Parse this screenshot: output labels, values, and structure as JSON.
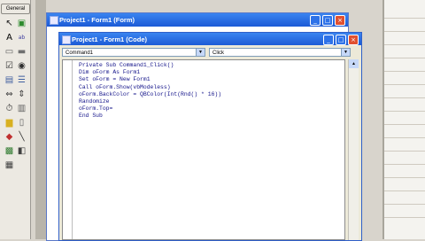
{
  "toolbox": {
    "tab_label": "General",
    "tools": [
      {
        "name": "pointer-icon",
        "glyph": "↖",
        "color": "#202020"
      },
      {
        "name": "picturebox-icon",
        "glyph": "▣",
        "color": "#2e8b2e"
      },
      {
        "name": "label-icon",
        "glyph": "A",
        "color": "#000000"
      },
      {
        "name": "textbox-icon",
        "glyph": "ab",
        "color": "#4040a0"
      },
      {
        "name": "frame-icon",
        "glyph": "▭",
        "color": "#606060"
      },
      {
        "name": "commandbutton-icon",
        "glyph": "▬",
        "color": "#707070"
      },
      {
        "name": "checkbox-icon",
        "glyph": "☑",
        "color": "#303030"
      },
      {
        "name": "optionbutton-icon",
        "glyph": "◉",
        "color": "#303030"
      },
      {
        "name": "combobox-icon",
        "glyph": "▤",
        "color": "#4060a0"
      },
      {
        "name": "listbox-icon",
        "glyph": "☰",
        "color": "#4060a0"
      },
      {
        "name": "hscroll-icon",
        "glyph": "⇔",
        "color": "#404040"
      },
      {
        "name": "vscroll-icon",
        "glyph": "⇕",
        "color": "#404040"
      },
      {
        "name": "timer-icon",
        "glyph": "⏱",
        "color": "#303030"
      },
      {
        "name": "drivelistbox-icon",
        "glyph": "▥",
        "color": "#606060"
      },
      {
        "name": "dirlistbox-icon",
        "glyph": "▆",
        "color": "#d8b020"
      },
      {
        "name": "filelistbox-icon",
        "glyph": "▯",
        "color": "#606060"
      },
      {
        "name": "shape-icon",
        "glyph": "◆",
        "color": "#c03030"
      },
      {
        "name": "line-icon",
        "glyph": "╲",
        "color": "#303030"
      },
      {
        "name": "image-icon",
        "glyph": "▩",
        "color": "#2e7a2e"
      },
      {
        "name": "data-icon",
        "glyph": "◧",
        "color": "#404040"
      },
      {
        "name": "ole-icon",
        "glyph": "▦",
        "color": "#404040"
      }
    ]
  },
  "form_window": {
    "title": "Project1 - Form1 (Form)",
    "buttons": [
      "_",
      "□",
      "×"
    ]
  },
  "code_window": {
    "title": "Project1 - Form1 (Code)",
    "buttons": [
      "_",
      "□",
      "×"
    ],
    "object_combo": "Command1",
    "procedure_combo": "Click",
    "lines": [
      "Private Sub Command1_Click()",
      "Dim oForm As Form1",
      "Set oForm = New Form1",
      "Call oForm.Show(vbModeless)",
      "oForm.BackColor = QBColor(Int(Rnd() * 16))",
      "Randomize",
      "oForm.Top=",
      "End Sub"
    ]
  }
}
